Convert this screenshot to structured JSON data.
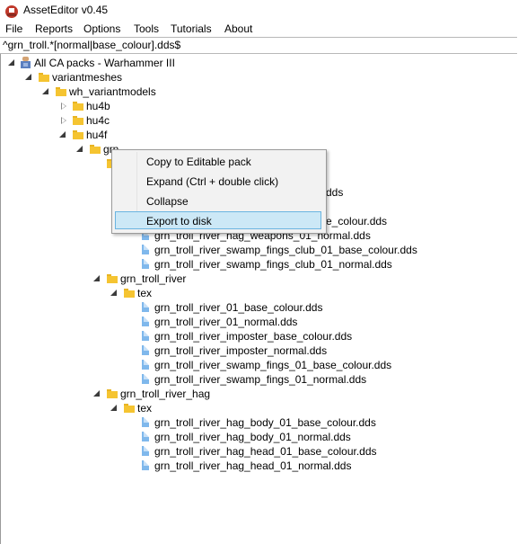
{
  "window": {
    "title": "AssetEditor v0.45"
  },
  "menu": {
    "items": [
      {
        "label": "File"
      },
      {
        "label": "Reports"
      },
      {
        "label": "Options"
      },
      {
        "label": "Tools"
      },
      {
        "label": "Tutorials"
      },
      {
        "label": "About"
      }
    ]
  },
  "filter": {
    "value": "^grn_troll.*[normal|base_colour].dds$"
  },
  "tree": {
    "root": "All CA packs - Warhammer III",
    "variantmeshes": "variantmeshes",
    "wh_variantmodels": "wh_variantmodels",
    "hu4b": "hu4b",
    "hu4c": "hu4c",
    "hu4f": "hu4f",
    "grn_partial": "grn",
    "partial_file_1": "dds",
    "partial_file_2": "e_colour.dds",
    "hag_weapons_normal": "grn_troll_river_hag_weapons_01_normal.dds",
    "club_base": "grn_troll_river_swamp_fings_club_01_base_colour.dds",
    "club_normal": "grn_troll_river_swamp_fings_club_01_normal.dds",
    "grn_troll_river": "grn_troll_river",
    "tex_1": "tex",
    "river_files": [
      "grn_troll_river_01_base_colour.dds",
      "grn_troll_river_01_normal.dds",
      "grn_troll_river_imposter_base_colour.dds",
      "grn_troll_river_imposter_normal.dds",
      "grn_troll_river_swamp_fings_01_base_colour.dds",
      "grn_troll_river_swamp_fings_01_normal.dds"
    ],
    "grn_troll_river_hag": "grn_troll_river_hag",
    "tex_2": "tex",
    "hag_files": [
      "grn_troll_river_hag_body_01_base_colour.dds",
      "grn_troll_river_hag_body_01_normal.dds",
      "grn_troll_river_hag_head_01_base_colour.dds",
      "grn_troll_river_hag_head_01_normal.dds"
    ]
  },
  "context_menu": {
    "items": [
      {
        "label": "Copy to Editable pack"
      },
      {
        "label": "Expand (Ctrl + double click)"
      },
      {
        "label": "Collapse"
      },
      {
        "label": "Export to disk",
        "highlighted": true
      }
    ]
  },
  "colors": {
    "folder": "#f5c431",
    "file": "#7fb8ec",
    "highlight": "#cce8f6",
    "highlight_border": "#6ab4e0"
  }
}
